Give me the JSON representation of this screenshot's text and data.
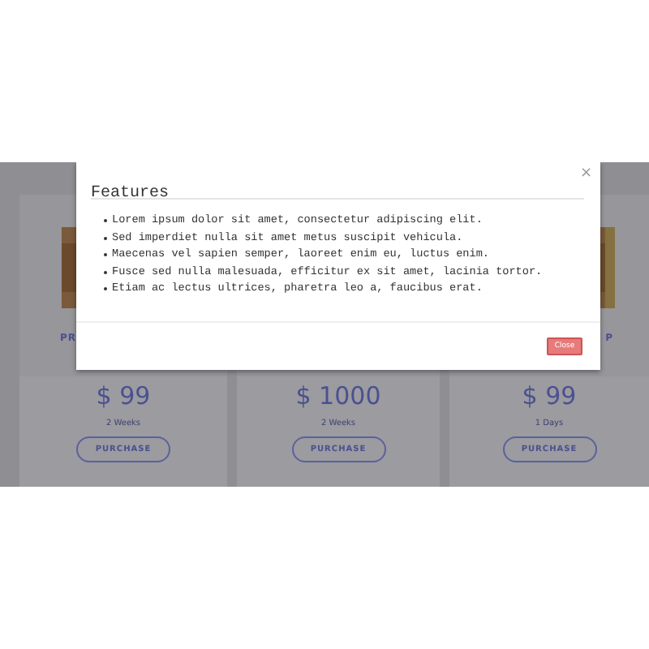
{
  "cards": [
    {
      "title": "PR",
      "price": "$ 99",
      "period": "2 Weeks",
      "button": "PURCHASE"
    },
    {
      "price": "$ 1000",
      "period": "2 Weeks",
      "button": "PURCHASE"
    },
    {
      "title": "P",
      "price": "$ 99",
      "period": "1 Days",
      "button": "PURCHASE"
    }
  ],
  "modal": {
    "title": "Features",
    "close_icon": "×",
    "items": [
      "Lorem ipsum dolor sit amet, consectetur adipiscing elit.",
      "Sed imperdiet nulla sit amet metus suscipit vehicula.",
      "Maecenas vel sapien semper, laoreet enim eu, luctus enim.",
      "Fusce sed nulla malesuada, efficitur ex sit amet, lacinia tortor.",
      "Etiam ac lectus ultrices, pharetra leo a, faucibus erat."
    ],
    "button": "Close"
  }
}
